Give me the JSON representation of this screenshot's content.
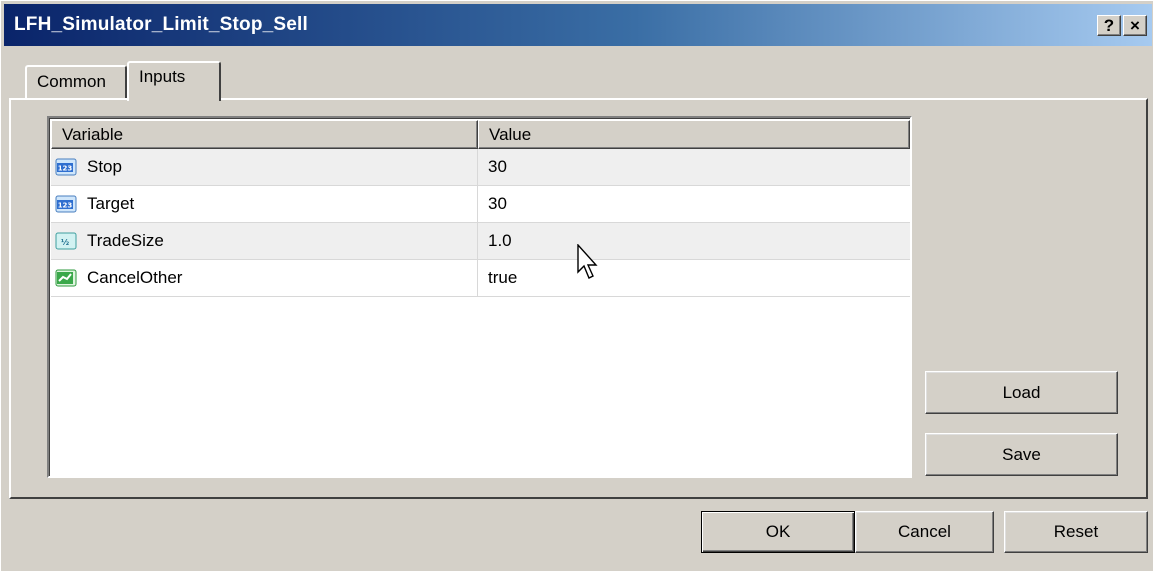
{
  "window": {
    "title": "LFH_Simulator_Limit_Stop_Sell",
    "help_label": "?",
    "close_label": "×"
  },
  "tabs": [
    {
      "label": "Common",
      "active": false
    },
    {
      "label": "Inputs",
      "active": true
    }
  ],
  "table": {
    "columns": [
      "Variable",
      "Value"
    ],
    "rows": [
      {
        "icon": "integer-icon",
        "variable": "Stop",
        "value": "30"
      },
      {
        "icon": "integer-icon",
        "variable": "Target",
        "value": "30"
      },
      {
        "icon": "double-icon",
        "variable": "TradeSize",
        "value": "1.0"
      },
      {
        "icon": "bool-icon",
        "variable": "CancelOther",
        "value": "true"
      }
    ]
  },
  "side_buttons": {
    "load": "Load",
    "save": "Save"
  },
  "footer_buttons": {
    "ok": "OK",
    "cancel": "Cancel",
    "reset": "Reset"
  },
  "colors": {
    "title_gradient_start": "#0a246a",
    "title_gradient_end": "#a6caf0",
    "face": "#d4d0c8"
  }
}
